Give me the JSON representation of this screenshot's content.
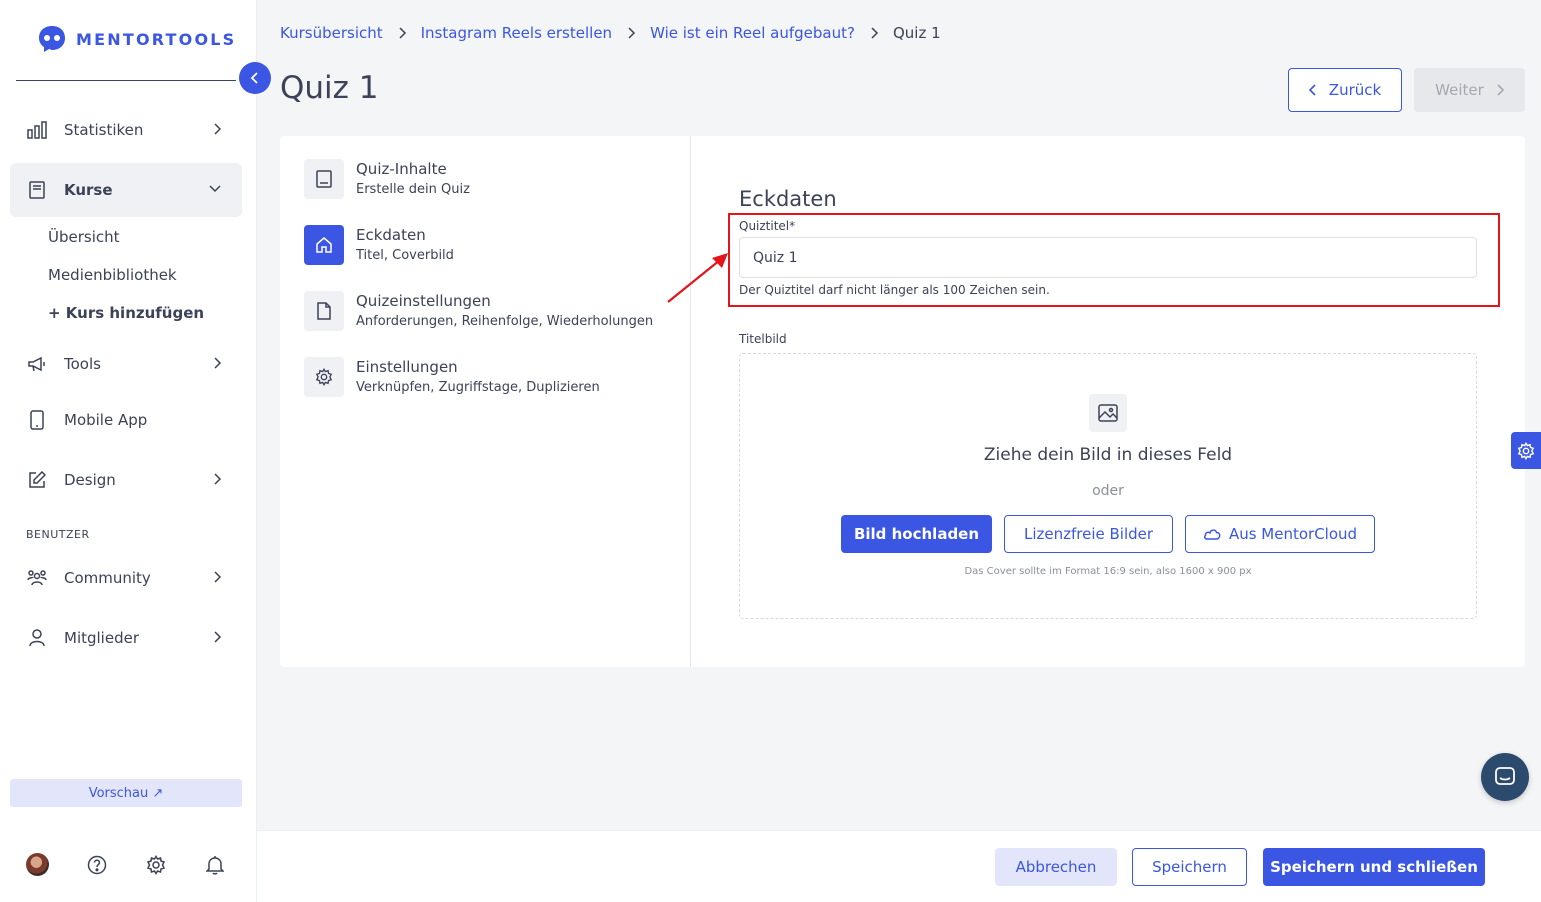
{
  "brand": {
    "name": "MENTORTOOLS"
  },
  "sidebar": {
    "items": [
      {
        "label": "Statistiken",
        "icon": "bar-chart-icon"
      },
      {
        "label": "Kurse",
        "icon": "book-icon"
      },
      {
        "label": "Tools",
        "icon": "megaphone-icon"
      },
      {
        "label": "Mobile App",
        "icon": "phone-icon"
      },
      {
        "label": "Design",
        "icon": "edit-icon"
      },
      {
        "label": "Community",
        "icon": "users-icon"
      },
      {
        "label": "Mitglieder",
        "icon": "user-icon"
      }
    ],
    "sub_items": [
      "Übersicht",
      "Medienbibliothek",
      "+ Kurs hinzufügen"
    ],
    "section_label": "BENUTZER",
    "preview_label": "Vorschau ↗"
  },
  "breadcrumb": {
    "items": [
      "Kursübersicht",
      "Instagram Reels erstellen",
      "Wie ist ein Reel aufgebaut?"
    ],
    "current": "Quiz 1"
  },
  "page": {
    "title": "Quiz 1",
    "back_label": "Zurück",
    "next_label": "Weiter"
  },
  "steps": [
    {
      "title": "Quiz-Inhalte",
      "subtitle": "Erstelle dein Quiz",
      "icon": "book-icon"
    },
    {
      "title": "Eckdaten",
      "subtitle": "Titel, Coverbild",
      "icon": "home-icon"
    },
    {
      "title": "Quizeinstellungen",
      "subtitle": "Anforderungen, Reihenfolge, Wiederholungen",
      "icon": "document-icon"
    },
    {
      "title": "Einstellungen",
      "subtitle": "Verknüpfen, Zugriffstage, Duplizieren",
      "icon": "gear-icon"
    }
  ],
  "form": {
    "section_title": "Eckdaten",
    "quiz_title_label": "Quiztitel*",
    "quiz_title_value": "Quiz 1",
    "quiz_title_hint": "Der Quiztitel darf nicht länger als 100 Zeichen sein.",
    "image_label": "Titelbild",
    "dropzone_title": "Ziehe dein Bild in dieses Feld",
    "dropzone_or": "oder",
    "upload_label": "Bild hochladen",
    "free_images_label": "Lizenzfreie Bilder",
    "mentorcloud_label": "Aus MentorCloud",
    "cover_note": "Das Cover sollte im Format 16:9 sein, also 1600 x 900 px"
  },
  "footer": {
    "cancel_label": "Abbrechen",
    "save_label": "Speichern",
    "save_close_label": "Speichern und schließen"
  },
  "colors": {
    "accent": "#3a56e3",
    "highlight": "#e3141b"
  }
}
